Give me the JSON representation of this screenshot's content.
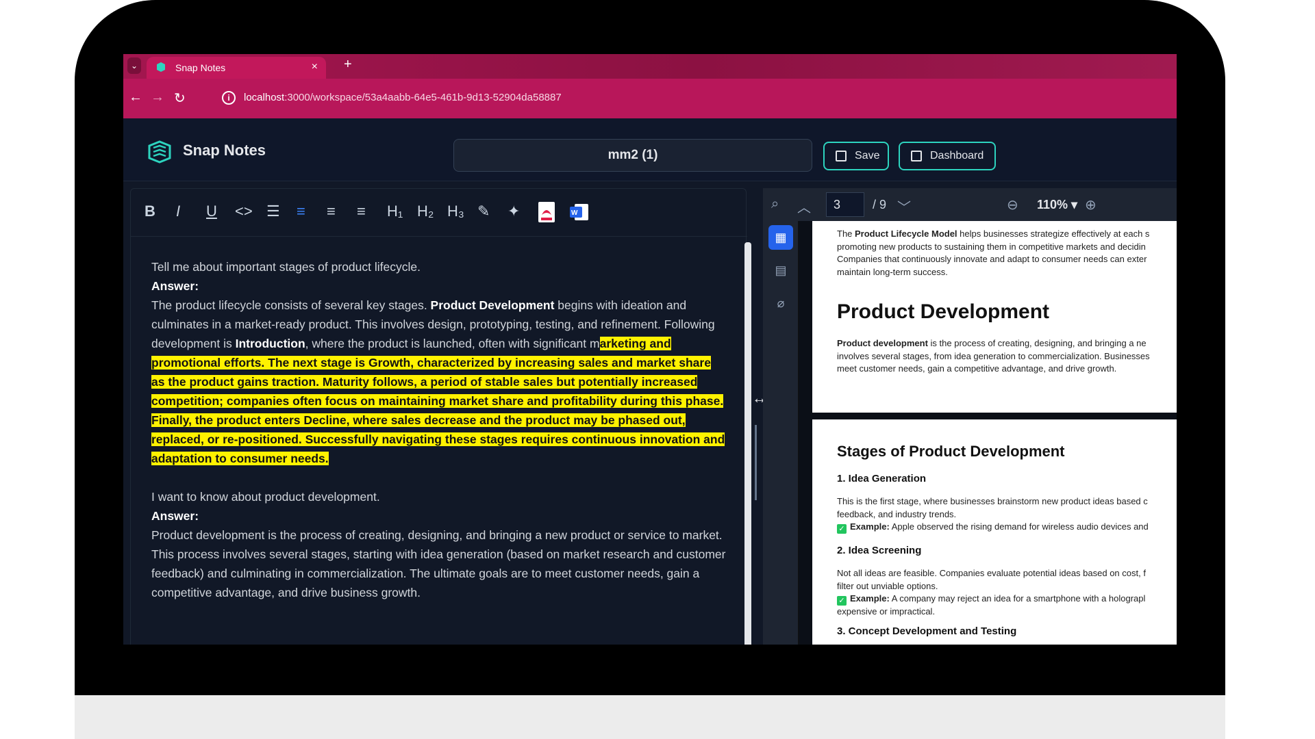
{
  "browser": {
    "tab_title": "Snap Notes",
    "new_tab": "+",
    "close": "×",
    "url_host": "localhost",
    "url_path": ":3000/workspace/53a4aabb-64e5-461b-9d13-52904da58887"
  },
  "header": {
    "brand": "Snap Notes",
    "document_name": "mm2 (1)",
    "save_label": "Save",
    "dashboard_label": "Dashboard"
  },
  "toolbar": {
    "bold": "B",
    "italic": "I",
    "underline": "U",
    "code": "<>",
    "h1": "H₁",
    "h2": "H₂",
    "h3": "H₃"
  },
  "editor": {
    "q1": "Tell me about important stages of product lifecycle.",
    "answer_label": "Answer:",
    "a1_p1": "The product lifecycle consists of several key stages. ",
    "a1_b1": "Product Development",
    "a1_p2": " begins with ideation and culminates in a market-ready product. This involves design, prototyping, testing, and refinement. Following development is ",
    "a1_b2": "Introduction",
    "a1_p3": ", where the product is launched, often with significant m",
    "a1_highlight": "arketing and promotional efforts. The next stage is Growth, characterized by increasing sales and market share as the product gains traction. Maturity follows, a period of stable sales but potentially increased competition; companies often focus on maintaining market share and profitability during this phase. Finally, the product enters Decline, where sales decrease and the product may be phased out, replaced, or re-positioned. Successfully navigating these stages requires continuous innovation and adaptation to consumer needs.",
    "q2": "I want to know about product development.",
    "a2": "Product development is the process of creating, designing, and bringing a new product or service to market. This process involves several stages, starting with idea generation (based on market research and customer feedback) and culminating in commercialization. The ultimate goals are to meet customer needs, gain a competitive advantage, and drive business growth."
  },
  "pdf": {
    "current_page": "3",
    "page_count": "/ 9",
    "zoom": "110% ▾",
    "page1": {
      "l1a": "The ",
      "l1b": "Product Lifecycle Model",
      "l1c": " helps businesses strategize effectively at each s",
      "l2": "promoting new products to sustaining them in competitive markets and decidin",
      "l3": "Companies that continuously innovate and adapt to consumer needs can exter",
      "l4": "maintain long-term success.",
      "heading": "Product Development",
      "p1a": "Product development",
      "p1b": " is the process of creating, designing, and bringing a ne",
      "p2": "involves several stages, from idea generation to commercialization. Businesses",
      "p3": "meet customer needs, gain a competitive advantage, and drive growth."
    },
    "page2": {
      "heading": "Stages of Product Development",
      "s1": "1. Idea Generation",
      "s1_l1": "This is the first stage, where businesses brainstorm new product ideas based c",
      "s1_l2": "feedback, and industry trends.",
      "s1_ex_label": "Example:",
      "s1_ex": " Apple observed the rising demand for wireless audio devices and",
      "s2": "2. Idea Screening",
      "s2_l1": "Not all ideas are feasible. Companies evaluate potential ideas based on cost, f",
      "s2_l2": "filter out unviable options.",
      "s2_ex_label": "Example:",
      "s2_ex": " A company may reject an idea for a smartphone with a holograpl",
      "s2_l3": "expensive or impractical.",
      "s3": "3. Concept Development and Testing"
    }
  },
  "colors": {
    "accent": "#2dd4bf",
    "browser": "#b8175a",
    "highlight": "#fff200"
  }
}
